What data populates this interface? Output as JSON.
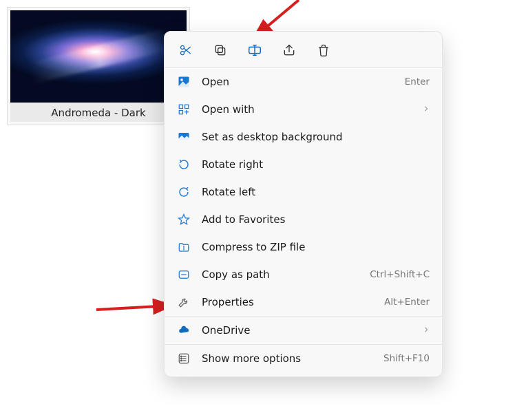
{
  "file": {
    "label": "Andromeda - Dark"
  },
  "toolbar": {
    "cut_title": "Cut",
    "copy_title": "Copy",
    "rename_title": "Rename",
    "share_title": "Share",
    "delete_title": "Delete"
  },
  "menu": {
    "open": {
      "label": "Open",
      "shortcut": "Enter"
    },
    "open_with": {
      "label": "Open with"
    },
    "set_bg": {
      "label": "Set as desktop background"
    },
    "rotate_right": {
      "label": "Rotate right"
    },
    "rotate_left": {
      "label": "Rotate left"
    },
    "fav": {
      "label": "Add to Favorites"
    },
    "zip": {
      "label": "Compress to ZIP file"
    },
    "copy_path": {
      "label": "Copy as path",
      "shortcut": "Ctrl+Shift+C"
    },
    "props": {
      "label": "Properties",
      "shortcut": "Alt+Enter"
    },
    "onedrive": {
      "label": "OneDrive"
    },
    "more": {
      "label": "Show more options",
      "shortcut": "Shift+F10"
    }
  }
}
